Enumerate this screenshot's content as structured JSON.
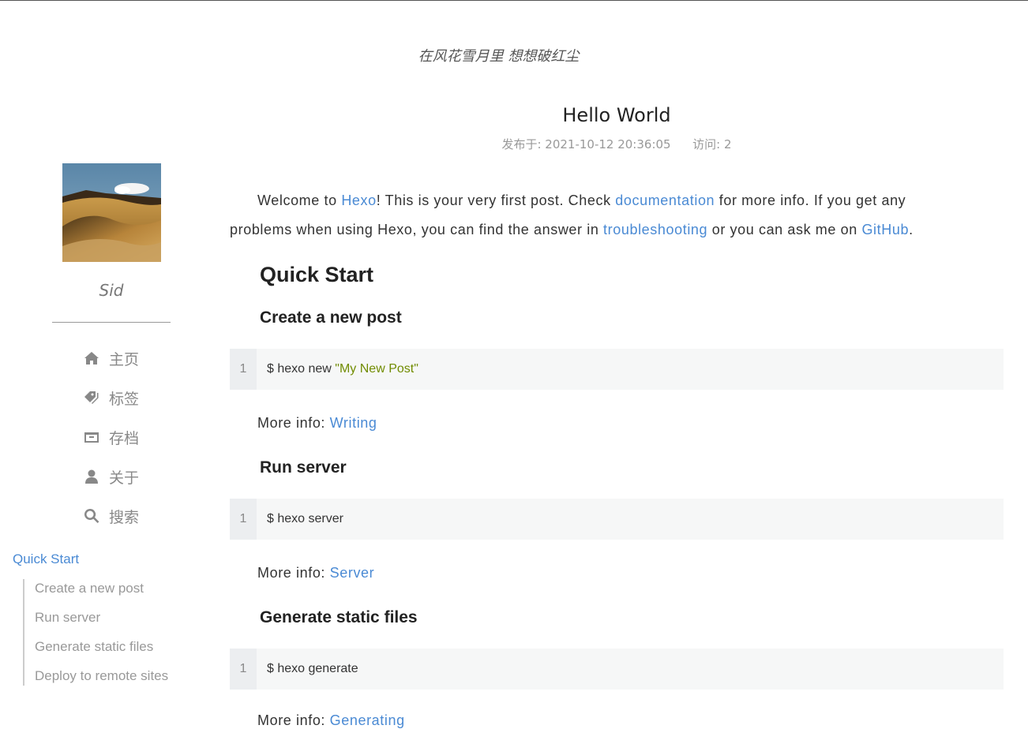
{
  "site": {
    "subtitle": "在风花雪月里 想想破红尘"
  },
  "sidebar": {
    "author": "Sid",
    "nav": [
      {
        "label": "主页",
        "icon": "home-icon"
      },
      {
        "label": "标签",
        "icon": "tags-icon"
      },
      {
        "label": "存档",
        "icon": "archive-icon"
      },
      {
        "label": "关于",
        "icon": "user-icon"
      },
      {
        "label": "搜索",
        "icon": "search-icon"
      }
    ],
    "toc": {
      "title": "Quick Start",
      "items": [
        "Create a new post",
        "Run server",
        "Generate static files",
        "Deploy to remote sites"
      ]
    }
  },
  "post": {
    "title": "Hello World",
    "meta": {
      "published_label": "发布于:",
      "published_value": "2021-10-12 20:36:05",
      "visits_label": "访问:",
      "visits_value": "2"
    },
    "intro": {
      "t1": "Welcome to ",
      "link_hexo": "Hexo",
      "t2": "! This is your very first post. Check ",
      "link_docs": "documentation",
      "t3": " for more info. If you get any problems when using Hexo, you can find the answer in ",
      "link_trouble": "troubleshooting",
      "t4": " or you can ask me on ",
      "link_github": "GitHub",
      "t5": "."
    },
    "h_quick_start": "Quick Start",
    "sections": [
      {
        "heading": "Create a new post",
        "line_no": "1",
        "code_prefix": "$ hexo new ",
        "code_string": "\"My New Post\"",
        "more_label": "More info: ",
        "more_link": "Writing"
      },
      {
        "heading": "Run server",
        "line_no": "1",
        "code_prefix": "$ hexo server",
        "code_string": "",
        "more_label": "More info: ",
        "more_link": "Server"
      },
      {
        "heading": "Generate static files",
        "line_no": "1",
        "code_prefix": "$ hexo generate",
        "code_string": "",
        "more_label": "More info: ",
        "more_link": "Generating"
      }
    ]
  },
  "colors": {
    "link": "#4a8ad4",
    "code_bg": "#f6f7f7",
    "code_string": "#718c00"
  }
}
